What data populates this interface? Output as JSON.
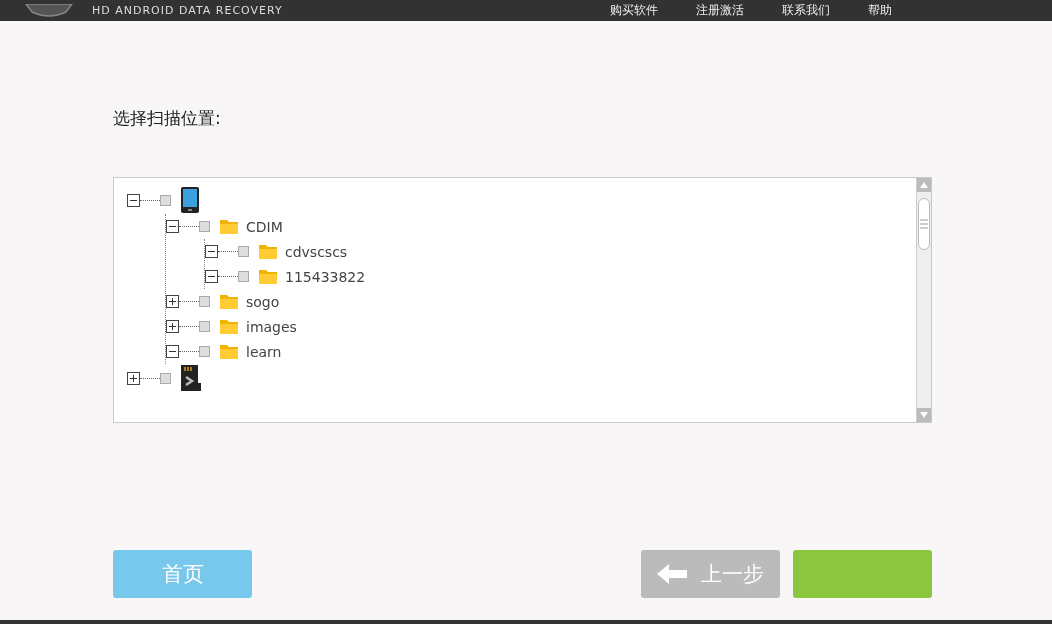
{
  "header": {
    "title": "HD ANDROID DATA RECOVERY",
    "menu": [
      "购买软件",
      "注册激活",
      "联系我们",
      "帮助"
    ]
  },
  "prompt": "选择扫描位置:",
  "tree": [
    {
      "kind": "phone",
      "expanded": true,
      "checked": false,
      "children": [
        {
          "kind": "folder",
          "label": "CDIM",
          "expanded": true,
          "checked": false,
          "children": [
            {
              "kind": "folder",
              "label": "cdvscscs",
              "expanded": true,
              "checked": false
            },
            {
              "kind": "folder",
              "label": "115433822",
              "expanded": true,
              "checked": false
            }
          ]
        },
        {
          "kind": "folder",
          "label": "sogo",
          "expanded": false,
          "checked": false
        },
        {
          "kind": "folder",
          "label": "images",
          "expanded": false,
          "checked": false
        },
        {
          "kind": "folder",
          "label": "learn",
          "expanded": true,
          "checked": false
        }
      ]
    },
    {
      "kind": "sdcard",
      "expanded": false,
      "checked": false
    }
  ],
  "buttons": [
    {
      "kind": "home",
      "label": "首页"
    },
    {
      "kind": "back",
      "label": "上一步"
    },
    {
      "kind": "next"
    }
  ]
}
